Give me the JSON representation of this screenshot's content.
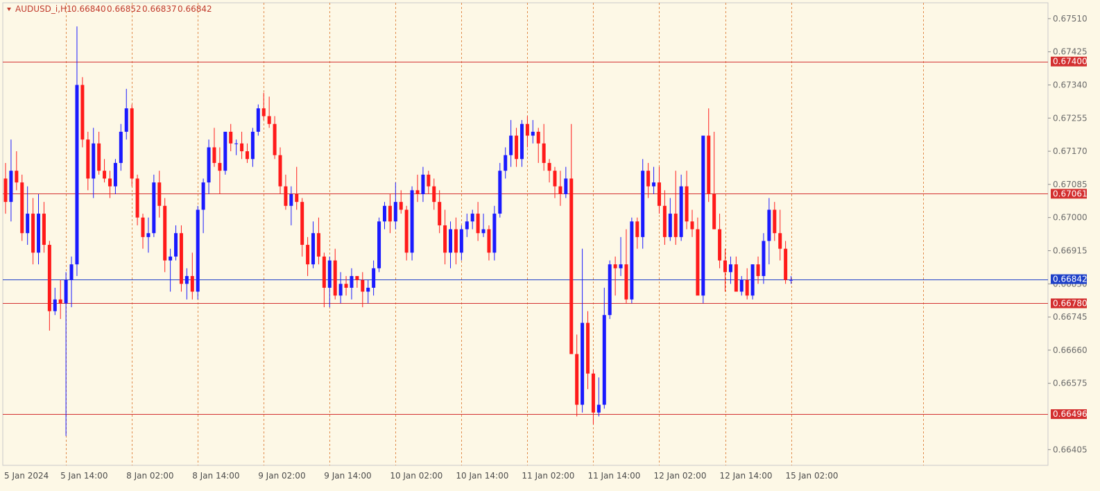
{
  "chart_data": {
    "type": "candlestick",
    "title": "AUDUSD_i,H1",
    "ohlc_header": {
      "open": "0.66840",
      "high": "0.66852",
      "low": "0.66837",
      "close": "0.66842"
    },
    "ylim": [
      0.6637,
      0.6754
    ],
    "y_ticks": [
      "0.67510",
      "0.67425",
      "0.67340",
      "0.67255",
      "0.67170",
      "0.67085",
      "0.67000",
      "0.66915",
      "0.66830",
      "0.66745",
      "0.66660",
      "0.66575",
      "0.66405"
    ],
    "x_labels": [
      {
        "label": "5 Jan 2024",
        "index": -1
      },
      {
        "label": "5 Jan 14:00",
        "index": 11
      },
      {
        "label": "8 Jan 02:00",
        "index": 23
      },
      {
        "label": "8 Jan 14:00",
        "index": 35
      },
      {
        "label": "9 Jan 02:00",
        "index": 47
      },
      {
        "label": "9 Jan 14:00",
        "index": 59
      },
      {
        "label": "10 Jan 02:00",
        "index": 71
      },
      {
        "label": "10 Jan 14:00",
        "index": 83
      },
      {
        "label": "11 Jan 02:00",
        "index": 95
      },
      {
        "label": "11 Jan 14:00",
        "index": 107
      },
      {
        "label": "12 Jan 02:00",
        "index": 119
      },
      {
        "label": "12 Jan 14:00",
        "index": 131
      },
      {
        "label": "15 Jan 02:00",
        "index": 143
      }
    ],
    "vgrid_indices": [
      11,
      23,
      35,
      47,
      59,
      71,
      83,
      95,
      107,
      119,
      131,
      143,
      167
    ],
    "hlines": [
      {
        "value": 0.674,
        "label": "0.67400",
        "color": "#d32f2f"
      },
      {
        "value": 0.67061,
        "label": "0.67061",
        "color": "#d32f2f"
      },
      {
        "value": 0.6678,
        "label": "0.66780",
        "color": "#d32f2f"
      },
      {
        "value": 0.66496,
        "label": "0.66496",
        "color": "#d32f2f"
      },
      {
        "value": 0.66842,
        "label": "0.66842",
        "color": "#1e40c8"
      }
    ],
    "colors": {
      "bull": "#1a1aff",
      "bear": "#ff1a1a",
      "bg": "#fdf8e6",
      "grid": "#e08a4a"
    },
    "candles": [
      [
        0.671,
        0.6714,
        0.6701,
        0.6704
      ],
      [
        0.6704,
        0.672,
        0.6699,
        0.6712
      ],
      [
        0.6712,
        0.6717,
        0.6707,
        0.6709
      ],
      [
        0.6709,
        0.6711,
        0.6694,
        0.6696
      ],
      [
        0.6696,
        0.6708,
        0.6693,
        0.6701
      ],
      [
        0.6701,
        0.6705,
        0.6688,
        0.6691
      ],
      [
        0.6691,
        0.6706,
        0.6688,
        0.6701
      ],
      [
        0.6701,
        0.6704,
        0.6691,
        0.6693
      ],
      [
        0.6693,
        0.6694,
        0.6671,
        0.6676
      ],
      [
        0.6676,
        0.6682,
        0.6675,
        0.6679
      ],
      [
        0.6679,
        0.6684,
        0.6674,
        0.6678
      ],
      [
        0.6678,
        0.6686,
        0.6644,
        0.6684
      ],
      [
        0.6684,
        0.669,
        0.6677,
        0.6688
      ],
      [
        0.6688,
        0.6749,
        0.6685,
        0.6734
      ],
      [
        0.6734,
        0.6736,
        0.6718,
        0.672
      ],
      [
        0.672,
        0.6722,
        0.6707,
        0.671
      ],
      [
        0.671,
        0.6723,
        0.6705,
        0.6719
      ],
      [
        0.6719,
        0.6722,
        0.6711,
        0.6712
      ],
      [
        0.6712,
        0.6715,
        0.6709,
        0.671
      ],
      [
        0.671,
        0.6712,
        0.6705,
        0.6708
      ],
      [
        0.6708,
        0.6715,
        0.6706,
        0.6714
      ],
      [
        0.6714,
        0.6724,
        0.6712,
        0.6722
      ],
      [
        0.6722,
        0.6733,
        0.672,
        0.6728
      ],
      [
        0.6728,
        0.6729,
        0.6708,
        0.671
      ],
      [
        0.671,
        0.6711,
        0.6698,
        0.67
      ],
      [
        0.67,
        0.6701,
        0.6692,
        0.6695
      ],
      [
        0.6695,
        0.67,
        0.6691,
        0.6696
      ],
      [
        0.6696,
        0.6711,
        0.6695,
        0.6709
      ],
      [
        0.6709,
        0.6712,
        0.67,
        0.6703
      ],
      [
        0.6703,
        0.6705,
        0.6686,
        0.6689
      ],
      [
        0.6689,
        0.6692,
        0.6681,
        0.669
      ],
      [
        0.669,
        0.6698,
        0.6689,
        0.6696
      ],
      [
        0.6696,
        0.6698,
        0.6681,
        0.6683
      ],
      [
        0.6683,
        0.6687,
        0.6679,
        0.6685
      ],
      [
        0.6685,
        0.6691,
        0.6679,
        0.6681
      ],
      [
        0.6681,
        0.6703,
        0.6679,
        0.6702
      ],
      [
        0.6702,
        0.671,
        0.6696,
        0.6709
      ],
      [
        0.6709,
        0.672,
        0.6706,
        0.6718
      ],
      [
        0.6718,
        0.6723,
        0.6713,
        0.6714
      ],
      [
        0.6714,
        0.6718,
        0.6706,
        0.6712
      ],
      [
        0.6712,
        0.6722,
        0.6711,
        0.6722
      ],
      [
        0.6722,
        0.6724,
        0.6717,
        0.6719
      ],
      [
        0.6719,
        0.672,
        0.6716,
        0.6719
      ],
      [
        0.6719,
        0.6722,
        0.6715,
        0.6717
      ],
      [
        0.6717,
        0.6719,
        0.6714,
        0.6715
      ],
      [
        0.6715,
        0.6723,
        0.6713,
        0.6722
      ],
      [
        0.6722,
        0.6729,
        0.6721,
        0.6728
      ],
      [
        0.6728,
        0.6732,
        0.6725,
        0.6726
      ],
      [
        0.6726,
        0.6731,
        0.6723,
        0.6724
      ],
      [
        0.6724,
        0.6726,
        0.6715,
        0.6716
      ],
      [
        0.6716,
        0.6718,
        0.6706,
        0.6708
      ],
      [
        0.6708,
        0.6711,
        0.6702,
        0.6703
      ],
      [
        0.6703,
        0.6708,
        0.6698,
        0.6706
      ],
      [
        0.6706,
        0.6713,
        0.6702,
        0.6704
      ],
      [
        0.6704,
        0.6705,
        0.669,
        0.6693
      ],
      [
        0.6693,
        0.6695,
        0.6685,
        0.6688
      ],
      [
        0.6688,
        0.6699,
        0.6687,
        0.6696
      ],
      [
        0.6696,
        0.67,
        0.6688,
        0.669
      ],
      [
        0.669,
        0.6691,
        0.6677,
        0.6682
      ],
      [
        0.6682,
        0.669,
        0.6677,
        0.6689
      ],
      [
        0.6689,
        0.6692,
        0.6679,
        0.668
      ],
      [
        0.668,
        0.6686,
        0.6678,
        0.6683
      ],
      [
        0.6683,
        0.6685,
        0.668,
        0.6682
      ],
      [
        0.6682,
        0.6687,
        0.6679,
        0.6685
      ],
      [
        0.6685,
        0.6685,
        0.6682,
        0.6684
      ],
      [
        0.6684,
        0.6686,
        0.6677,
        0.6681
      ],
      [
        0.6681,
        0.6684,
        0.6678,
        0.6682
      ],
      [
        0.6682,
        0.6689,
        0.668,
        0.6687
      ],
      [
        0.6687,
        0.67,
        0.6686,
        0.6699
      ],
      [
        0.6699,
        0.6704,
        0.6697,
        0.6703
      ],
      [
        0.6703,
        0.6706,
        0.6696,
        0.6699
      ],
      [
        0.6699,
        0.6709,
        0.6697,
        0.6704
      ],
      [
        0.6704,
        0.6707,
        0.6701,
        0.6702
      ],
      [
        0.6702,
        0.6703,
        0.6689,
        0.6691
      ],
      [
        0.6691,
        0.6708,
        0.6689,
        0.6707
      ],
      [
        0.6707,
        0.6711,
        0.6704,
        0.6706
      ],
      [
        0.6706,
        0.6713,
        0.6704,
        0.6711
      ],
      [
        0.6711,
        0.6712,
        0.6706,
        0.6708
      ],
      [
        0.6708,
        0.671,
        0.6702,
        0.6704
      ],
      [
        0.6704,
        0.6707,
        0.6696,
        0.6698
      ],
      [
        0.6698,
        0.6702,
        0.6688,
        0.6691
      ],
      [
        0.6691,
        0.6699,
        0.6687,
        0.6697
      ],
      [
        0.6697,
        0.67,
        0.6688,
        0.6691
      ],
      [
        0.6691,
        0.6698,
        0.6689,
        0.6697
      ],
      [
        0.6697,
        0.6701,
        0.6695,
        0.6699
      ],
      [
        0.6699,
        0.6702,
        0.6697,
        0.6701
      ],
      [
        0.6701,
        0.6704,
        0.6694,
        0.6696
      ],
      [
        0.6696,
        0.6701,
        0.6695,
        0.6697
      ],
      [
        0.6697,
        0.6698,
        0.6689,
        0.6691
      ],
      [
        0.6691,
        0.6703,
        0.6689,
        0.6701
      ],
      [
        0.6701,
        0.6714,
        0.67,
        0.6712
      ],
      [
        0.6712,
        0.6718,
        0.671,
        0.6716
      ],
      [
        0.6716,
        0.6725,
        0.6713,
        0.6721
      ],
      [
        0.6721,
        0.6723,
        0.6713,
        0.6715
      ],
      [
        0.6715,
        0.6725,
        0.6713,
        0.6724
      ],
      [
        0.6724,
        0.6726,
        0.6718,
        0.6721
      ],
      [
        0.6721,
        0.6725,
        0.6719,
        0.6722
      ],
      [
        0.6722,
        0.6723,
        0.6714,
        0.6719
      ],
      [
        0.6719,
        0.6724,
        0.6712,
        0.6714
      ],
      [
        0.6714,
        0.6715,
        0.6709,
        0.6712
      ],
      [
        0.6712,
        0.6713,
        0.6705,
        0.6708
      ],
      [
        0.6708,
        0.6712,
        0.6703,
        0.6706
      ],
      [
        0.6706,
        0.6713,
        0.6705,
        0.671
      ],
      [
        0.671,
        0.6724,
        0.6698,
        0.6665
      ],
      [
        0.6665,
        0.667,
        0.6649,
        0.6652
      ],
      [
        0.6652,
        0.6692,
        0.665,
        0.6673
      ],
      [
        0.6673,
        0.6676,
        0.6656,
        0.666
      ],
      [
        0.666,
        0.6661,
        0.6647,
        0.665
      ],
      [
        0.665,
        0.6659,
        0.6649,
        0.6652
      ],
      [
        0.6652,
        0.6682,
        0.6651,
        0.6675
      ],
      [
        0.6675,
        0.6689,
        0.6674,
        0.6688
      ],
      [
        0.6688,
        0.669,
        0.668,
        0.6687
      ],
      [
        0.6687,
        0.6695,
        0.6685,
        0.6688
      ],
      [
        0.6688,
        0.6697,
        0.6678,
        0.6679
      ],
      [
        0.6679,
        0.67,
        0.6678,
        0.6699
      ],
      [
        0.6699,
        0.67,
        0.6692,
        0.6695
      ],
      [
        0.6695,
        0.6715,
        0.6692,
        0.6712
      ],
      [
        0.6712,
        0.6714,
        0.6705,
        0.6708
      ],
      [
        0.6708,
        0.6713,
        0.6706,
        0.6709
      ],
      [
        0.6709,
        0.6713,
        0.6701,
        0.6703
      ],
      [
        0.6703,
        0.6707,
        0.6693,
        0.6695
      ],
      [
        0.6695,
        0.6705,
        0.6694,
        0.6701
      ],
      [
        0.6701,
        0.6712,
        0.6693,
        0.6695
      ],
      [
        0.6695,
        0.6711,
        0.6694,
        0.6708
      ],
      [
        0.6708,
        0.6712,
        0.6697,
        0.6699
      ],
      [
        0.6699,
        0.6702,
        0.6695,
        0.6697
      ],
      [
        0.6697,
        0.67,
        0.6688,
        0.668
      ],
      [
        0.668,
        0.6712,
        0.6678,
        0.6721
      ],
      [
        0.6721,
        0.6728,
        0.6704,
        0.6706
      ],
      [
        0.6706,
        0.6722,
        0.6697,
        0.6697
      ],
      [
        0.6697,
        0.6701,
        0.6687,
        0.6689
      ],
      [
        0.6689,
        0.6692,
        0.6681,
        0.6686
      ],
      [
        0.6686,
        0.669,
        0.6683,
        0.6688
      ],
      [
        0.6688,
        0.669,
        0.6682,
        0.6681
      ],
      [
        0.6681,
        0.6685,
        0.668,
        0.6684
      ],
      [
        0.6684,
        0.6687,
        0.6679,
        0.668
      ],
      [
        0.668,
        0.6688,
        0.6679,
        0.6688
      ],
      [
        0.6688,
        0.669,
        0.6683,
        0.6685
      ],
      [
        0.6685,
        0.6696,
        0.6683,
        0.6694
      ],
      [
        0.6694,
        0.6705,
        0.6688,
        0.6702
      ],
      [
        0.6702,
        0.6704,
        0.6694,
        0.6696
      ],
      [
        0.6696,
        0.6702,
        0.6689,
        0.6692
      ],
      [
        0.6692,
        0.6694,
        0.6683,
        0.6684
      ],
      [
        0.6684,
        0.6685,
        0.6683,
        0.6684
      ]
    ]
  }
}
